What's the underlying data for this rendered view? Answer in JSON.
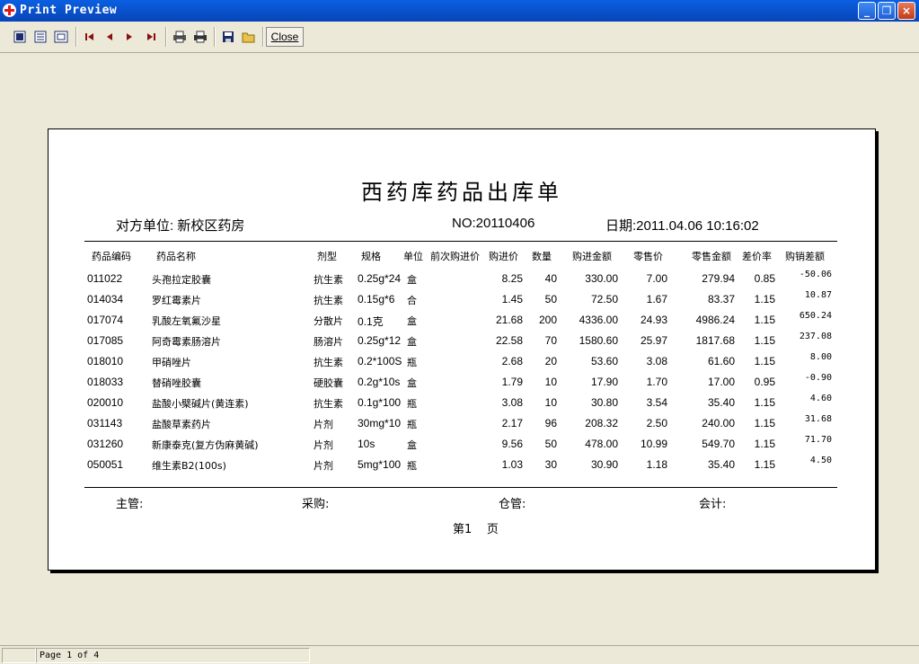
{
  "window": {
    "title": "Print Preview"
  },
  "toolbar": {
    "icons": [
      "page-view-icon",
      "multi-page-icon",
      "fit-page-icon",
      "first-page-icon",
      "prev-page-icon",
      "next-page-icon",
      "last-page-icon",
      "print-setup-icon",
      "print-icon",
      "save-icon",
      "open-icon"
    ],
    "close_label": "Close"
  },
  "document": {
    "title": "西药库药品出库单",
    "counterparty_label": "对方单位: 新校区药房",
    "number_label": "NO:20110406",
    "date_label": "日期:2011.04.06 10:16:02",
    "columns": [
      "药品编码",
      "药品名称",
      "剂型",
      "规格",
      "单位",
      "前次购进价",
      "购进价",
      "数量",
      "购进金额",
      "零售价",
      "零售金额",
      "差价率",
      "购销差额"
    ],
    "rows": [
      {
        "code": "011022",
        "name": "头孢拉定胶囊",
        "form": "抗生素",
        "spec": "0.25g*24",
        "unit": "盒",
        "prev": "",
        "price": "8.25",
        "qty": "40",
        "amount": "330.00",
        "retail": "7.00",
        "retail_amount": "279.94",
        "rate": "0.85",
        "diff": "-50.06"
      },
      {
        "code": "014034",
        "name": "罗红霉素片",
        "form": "抗生素",
        "spec": "0.15g*6",
        "unit": "合",
        "prev": "",
        "price": "1.45",
        "qty": "50",
        "amount": "72.50",
        "retail": "1.67",
        "retail_amount": "83.37",
        "rate": "1.15",
        "diff": "10.87"
      },
      {
        "code": "017074",
        "name": "乳酸左氧氟沙星",
        "form": "分散片",
        "spec": "0.1克",
        "unit": "盒",
        "prev": "",
        "price": "21.68",
        "qty": "200",
        "amount": "4336.00",
        "retail": "24.93",
        "retail_amount": "4986.24",
        "rate": "1.15",
        "diff": "650.24"
      },
      {
        "code": "017085",
        "name": "阿奇霉素肠溶片",
        "form": "肠溶片",
        "spec": "0.25g*12",
        "unit": "盒",
        "prev": "",
        "price": "22.58",
        "qty": "70",
        "amount": "1580.60",
        "retail": "25.97",
        "retail_amount": "1817.68",
        "rate": "1.15",
        "diff": "237.08"
      },
      {
        "code": "018010",
        "name": "甲硝唑片",
        "form": "抗生素",
        "spec": "0.2*100S",
        "unit": "瓶",
        "prev": "",
        "price": "2.68",
        "qty": "20",
        "amount": "53.60",
        "retail": "3.08",
        "retail_amount": "61.60",
        "rate": "1.15",
        "diff": "8.00"
      },
      {
        "code": "018033",
        "name": "替硝唑胶囊",
        "form": "硬胶囊",
        "spec": "0.2g*10s",
        "unit": "盒",
        "prev": "",
        "price": "1.79",
        "qty": "10",
        "amount": "17.90",
        "retail": "1.70",
        "retail_amount": "17.00",
        "rate": "0.95",
        "diff": "-0.90"
      },
      {
        "code": "020010",
        "name": "盐酸小檗碱片(黄连素)",
        "form": "抗生素",
        "spec": "0.1g*100",
        "unit": "瓶",
        "prev": "",
        "price": "3.08",
        "qty": "10",
        "amount": "30.80",
        "retail": "3.54",
        "retail_amount": "35.40",
        "rate": "1.15",
        "diff": "4.60"
      },
      {
        "code": "031143",
        "name": "盐酸草素药片",
        "form": "片剂",
        "spec": "30mg*10",
        "unit": "瓶",
        "prev": "",
        "price": "2.17",
        "qty": "96",
        "amount": "208.32",
        "retail": "2.50",
        "retail_amount": "240.00",
        "rate": "1.15",
        "diff": "31.68"
      },
      {
        "code": "031260",
        "name": "新康泰克(复方伪麻黄碱)",
        "form": "片剂",
        "spec": "10s",
        "unit": "盒",
        "prev": "",
        "price": "9.56",
        "qty": "50",
        "amount": "478.00",
        "retail": "10.99",
        "retail_amount": "549.70",
        "rate": "1.15",
        "diff": "71.70"
      },
      {
        "code": "050051",
        "name": "维生素B2(100s)",
        "form": "片剂",
        "spec": "5mg*100",
        "unit": "瓶",
        "prev": "",
        "price": "1.03",
        "qty": "30",
        "amount": "30.90",
        "retail": "1.18",
        "retail_amount": "35.40",
        "rate": "1.15",
        "diff": "4.50"
      }
    ],
    "signatures": [
      "主管:",
      "采购:",
      "仓管:",
      "会计:"
    ],
    "page_label_prefix": "第1",
    "page_label_suffix": "页"
  },
  "status": {
    "page_text": "Page 1 of 4"
  }
}
